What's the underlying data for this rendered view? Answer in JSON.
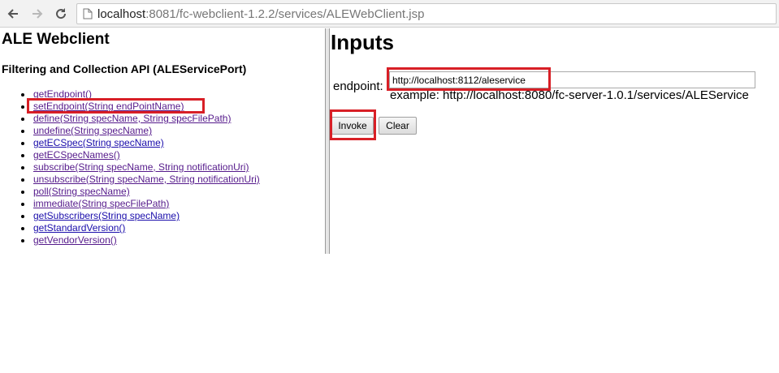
{
  "browser": {
    "url_host": "localhost",
    "url_path": ":8081/fc-webclient-1.2.2/services/ALEWebClient.jsp"
  },
  "left": {
    "title": "ALE Webclient",
    "subtitle": "Filtering and Collection API (ALEServicePort)",
    "methods": [
      "getEndpoint()",
      "setEndpoint(String endPointName)",
      "define(String specName, String specFilePath)",
      "undefine(String specName)",
      "getECSpec(String specName)",
      "getECSpecNames()",
      "subscribe(String specName, String notificationUri)",
      "unsubscribe(String specName, String notificationUri)",
      "poll(String specName)",
      "immediate(String specFilePath)",
      "getSubscribers(String specName)",
      "getStandardVersion()",
      "getVendorVersion()"
    ]
  },
  "right": {
    "title": "Inputs",
    "endpoint_label": "endpoint:",
    "endpoint_value": "http://localhost:8112/aleservice",
    "example": "example: http://localhost:8080/fc-server-1.0.1/services/ALEService",
    "invoke_label": "Invoke",
    "clear_label": "Clear"
  },
  "colors": {
    "link": "#1a0dab",
    "visited_link": "#551a8b",
    "annotation": "#d81f26"
  },
  "icons": [
    "back-arrow-icon",
    "forward-arrow-icon",
    "reload-icon",
    "page-icon"
  ]
}
